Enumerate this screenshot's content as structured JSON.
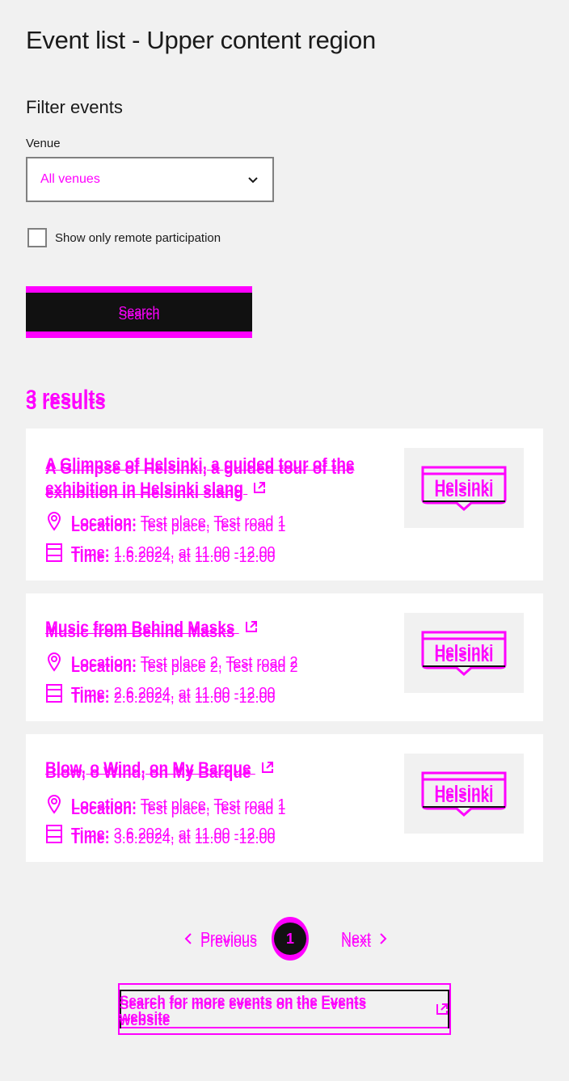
{
  "page": {
    "title": "Event list - Upper content region"
  },
  "filter": {
    "title": "Filter events",
    "venue_label": "Venue",
    "venue_value": "All venues",
    "remote_label": "Show only remote participation",
    "remote_checked": false,
    "search_label": "Search"
  },
  "results": {
    "count_label": "3 results"
  },
  "events": [
    {
      "title": "A Glimpse of Helsinki, a guided tour of the exhibition in Helsinki slang",
      "location_label": "Location:",
      "location": "Test place, Test road 1",
      "time_label": "Time:",
      "time": "1.6.2024, at 11.00 -12.00",
      "image_text": "Helsinki"
    },
    {
      "title": "Music from Behind Masks",
      "location_label": "Location:",
      "location": "Test place 2, Test road 2",
      "time_label": "Time:",
      "time": "2.6.2024, at 11.00 -12.00",
      "image_text": "Helsinki"
    },
    {
      "title": "Blow, o Wind, on My Barque",
      "location_label": "Location:",
      "location": "Test place, Test road 1",
      "time_label": "Time:",
      "time": "3.6.2024, at 11.00 -12.00",
      "image_text": "Helsinki"
    }
  ],
  "pagination": {
    "previous": "Previous",
    "current": "1",
    "next": "Next"
  },
  "more_events": {
    "label": "Search for more events on the Events website"
  },
  "icons": {
    "select": "chevron-down-icon",
    "external": "external-link-icon",
    "location": "location-icon",
    "time": "calendar-icon",
    "prev": "chevron-left-icon",
    "next": "chevron-right-icon"
  },
  "colors": {
    "accent": "#ff00ff",
    "background": "#f1f1f1",
    "dark": "#111111"
  }
}
